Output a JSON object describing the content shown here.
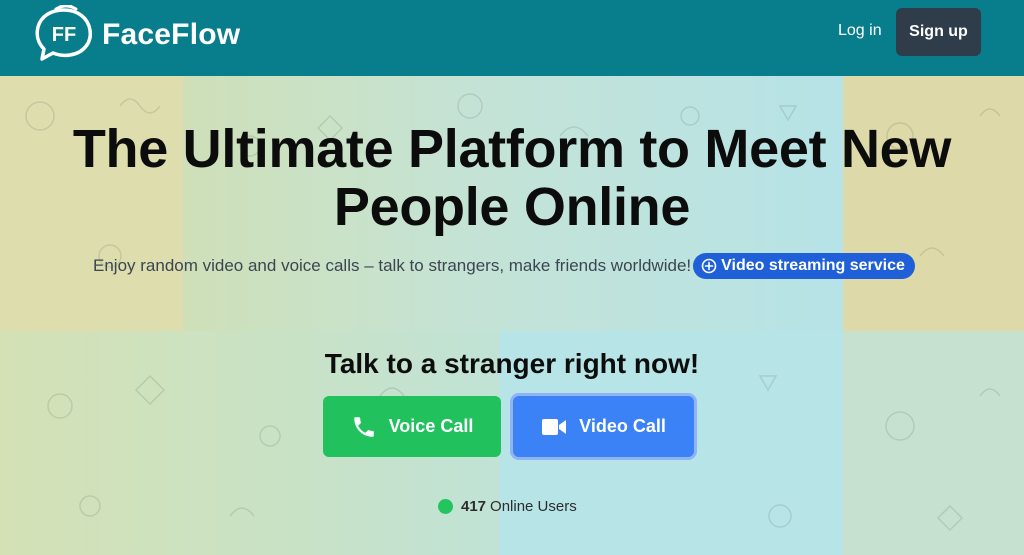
{
  "header": {
    "brand": "FaceFlow",
    "logo_letters": "FF",
    "login_label": "Log in",
    "signup_label": "Sign up"
  },
  "hero": {
    "title": "The Ultimate Platform to Meet New People Online",
    "subtitle": "Enjoy random video and voice calls – talk to strangers, make friends worldwide!",
    "badge_label": "Video streaming service"
  },
  "cta": {
    "title": "Talk to a stranger right now!",
    "voice_label": "Voice Call",
    "video_label": "Video Call"
  },
  "online": {
    "count": "417",
    "label": "Online Users"
  },
  "icons": {
    "logo": "faceflow-logo-icon",
    "badge": "plus-circle-icon",
    "voice": "phone-icon",
    "video": "video-camera-icon",
    "status": "online-dot-icon"
  },
  "colors": {
    "header": "#087e8c",
    "signup": "#2f3d4a",
    "badge": "#1f5fd8",
    "voice": "#21c15e",
    "video": "#3b82f6",
    "online_dot": "#22c55e"
  }
}
